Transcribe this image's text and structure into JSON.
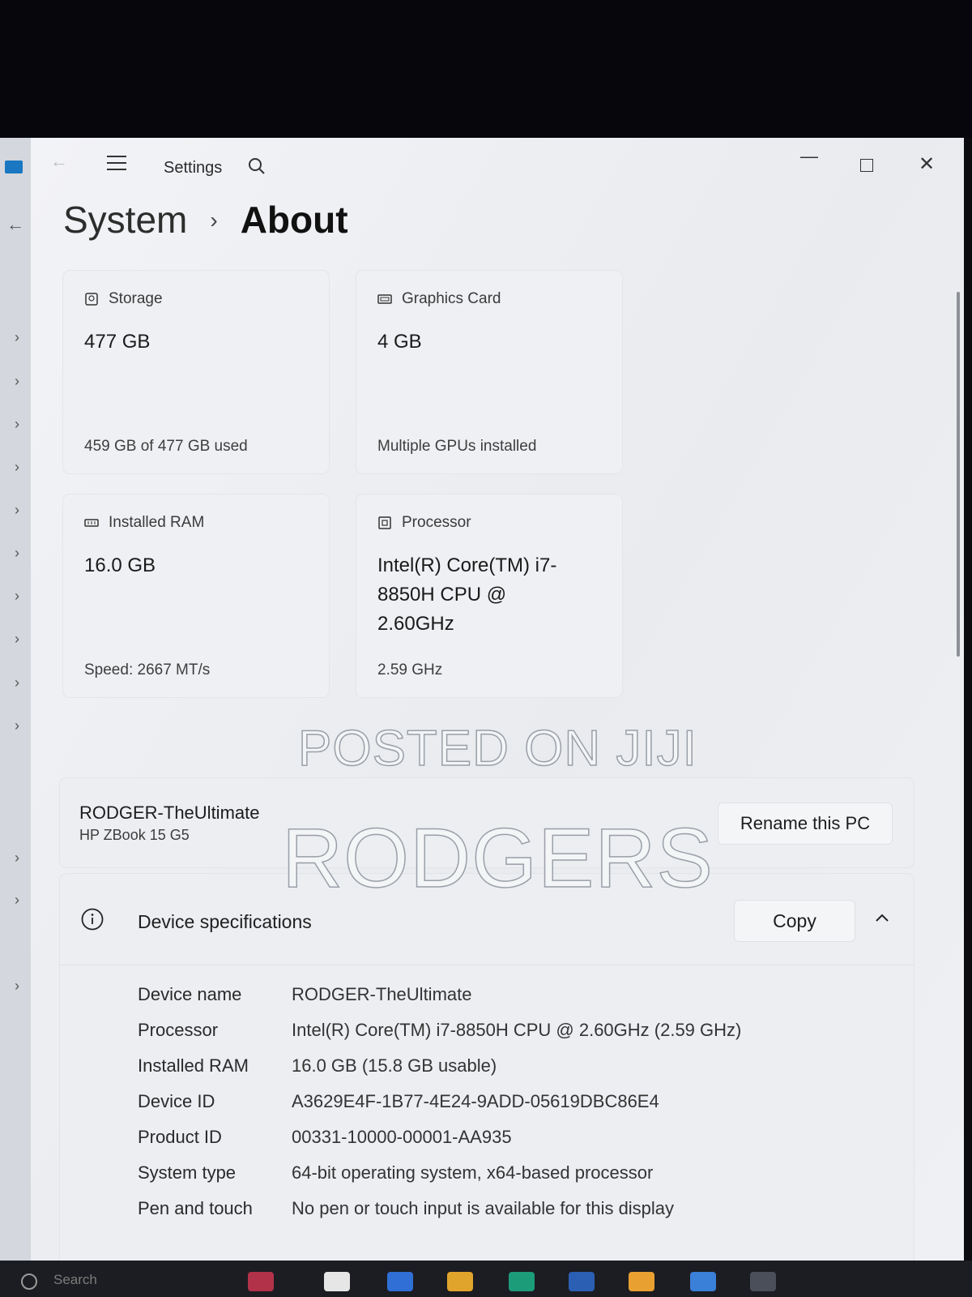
{
  "window": {
    "title": "Settings"
  },
  "breadcrumb": {
    "parent": "System",
    "separator": "›",
    "current": "About"
  },
  "cards": {
    "storage": {
      "label": "Storage",
      "value": "477 GB",
      "footer": "459 GB of 477 GB used"
    },
    "graphics": {
      "label": "Graphics Card",
      "value": "4 GB",
      "footer": "Multiple GPUs installed"
    },
    "ram": {
      "label": "Installed RAM",
      "value": "16.0 GB",
      "footer": "Speed: 2667 MT/s"
    },
    "processor": {
      "label": "Processor",
      "value": "Intel(R) Core(TM) i7-8850H CPU @ 2.60GHz",
      "footer": "2.59 GHz"
    }
  },
  "pc": {
    "name": "RODGER-TheUltimate",
    "model": "HP ZBook 15 G5",
    "rename_label": "Rename this PC"
  },
  "specs": {
    "title": "Device specifications",
    "copy_label": "Copy",
    "rows": [
      {
        "label": "Device name",
        "value": "RODGER-TheUltimate"
      },
      {
        "label": "Processor",
        "value": "Intel(R) Core(TM) i7-8850H CPU @ 2.60GHz (2.59 GHz)"
      },
      {
        "label": "Installed RAM",
        "value": "16.0 GB (15.8 GB usable)"
      },
      {
        "label": "Device ID",
        "value": "A3629E4F-1B77-4E24-9ADD-05619DBC86E4"
      },
      {
        "label": "Product ID",
        "value": "00331-10000-00001-AA935"
      },
      {
        "label": "System type",
        "value": "64-bit operating system, x64-based processor"
      },
      {
        "label": "Pen and touch",
        "value": "No pen or touch input is available for this display"
      }
    ]
  },
  "watermark": {
    "line1": "POSTED ON JIJI",
    "line2": "RODGERS"
  },
  "taskbar": {
    "search_placeholder": "Search"
  },
  "colors": {
    "window_bg": "#eef0f3",
    "accent": "#1a78c2",
    "bezel": "#06060c"
  }
}
